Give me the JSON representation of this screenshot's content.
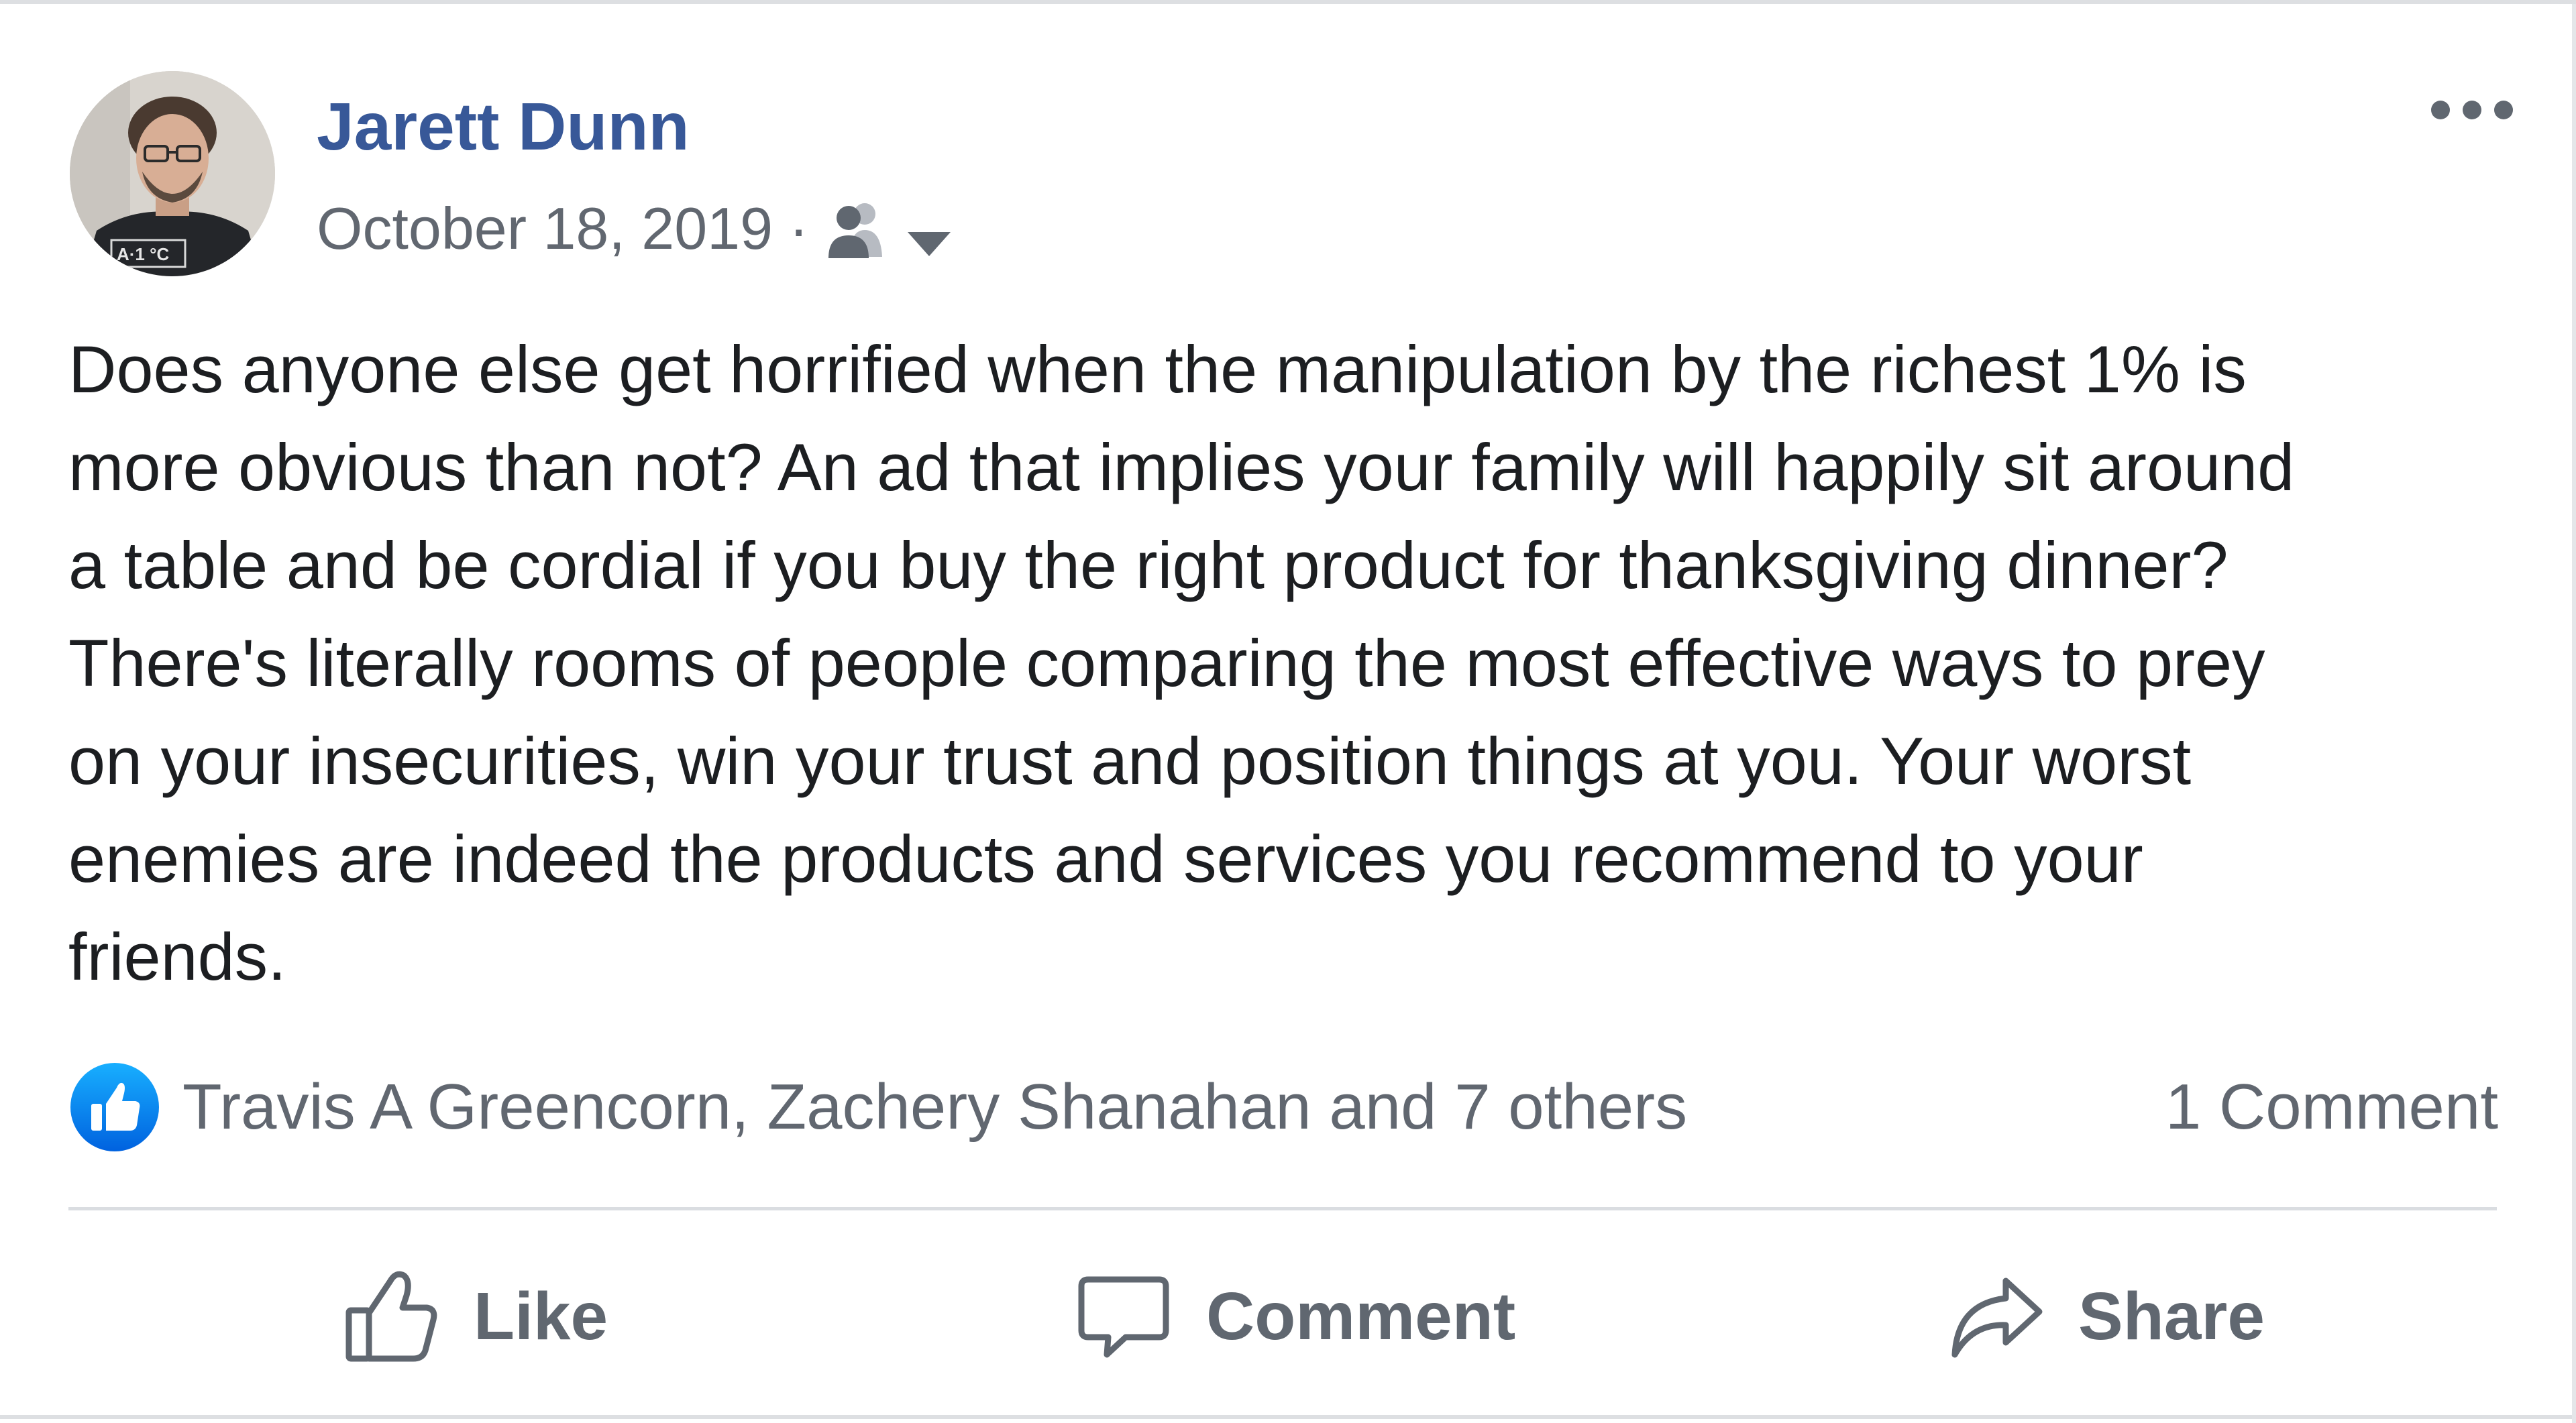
{
  "post": {
    "author": "Jarett Dunn",
    "date": "October 18, 2019",
    "separator": "·",
    "privacy_icon": "friends-icon",
    "audience_menu_icon": "caret-down-icon",
    "more_icon": "more-options-icon",
    "avatar_shirt_text": "A·1 °C",
    "text_lines": [
      "Does anyone else get horrified when the manipulation by the richest 1% is",
      "more obvious than not? An ad that implies your family will happily sit around",
      "a table and be cordial if you buy the right product for thanksgiving dinner?",
      "There's literally rooms of people comparing the most effective ways to prey",
      "on your insecurities, win your trust and position things at you. Your worst",
      "enemies are indeed the products and services you recommend to your",
      "friends."
    ]
  },
  "reactions": {
    "icon": "like-reaction-icon",
    "names": "Travis A Greencorn, Zachery Shanahan and 7 others",
    "comment_count": "1 Comment"
  },
  "actions": {
    "like": "Like",
    "comment": "Comment",
    "share": "Share"
  },
  "colors": {
    "author_link": "#385898",
    "secondary_text": "#616770",
    "body_text": "#1c1e21",
    "like_blue": "#1877f2",
    "action_text": "#606770",
    "divider": "#dadde1"
  }
}
